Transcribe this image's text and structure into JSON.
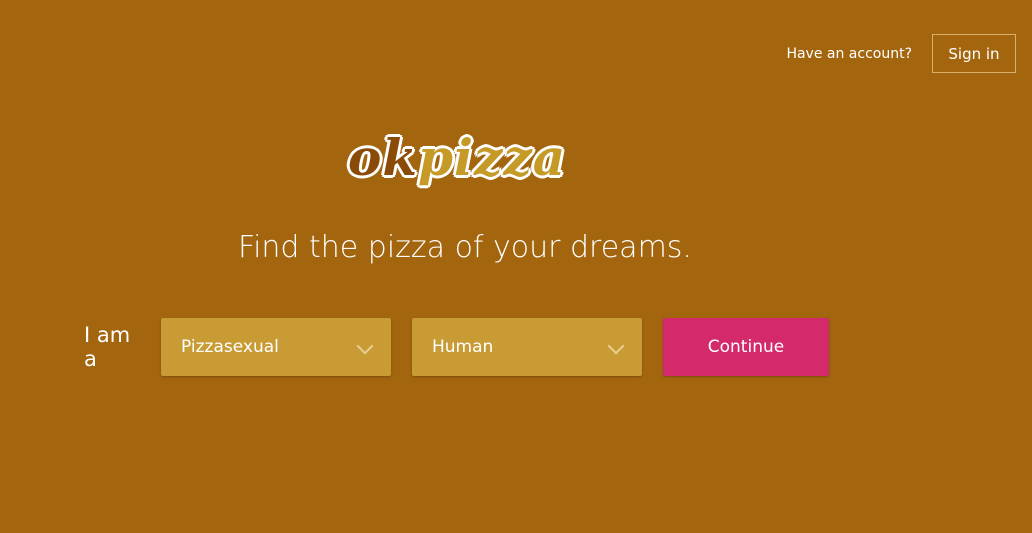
{
  "header": {
    "have_account_text": "Have an account?",
    "sign_in_label": "Sign in"
  },
  "logo": {
    "part1": "ok",
    "part2": "pizza"
  },
  "tagline": "Find the pizza of your dreams.",
  "form": {
    "prefix": "I am a",
    "orientation_select": {
      "selected": "Pizzasexual"
    },
    "species_select": {
      "selected": "Human"
    },
    "continue_label": "Continue"
  },
  "colors": {
    "background": "#a3660f",
    "select_bg": "#c99b34",
    "continue_bg": "#d42a6c",
    "logo_ok": "#8a4b08",
    "logo_pizza": "#c69a26"
  }
}
